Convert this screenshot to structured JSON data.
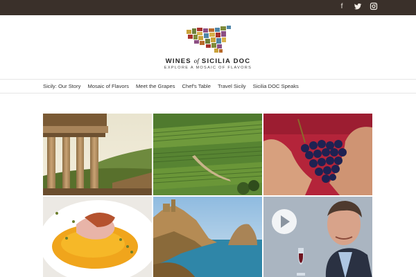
{
  "social": {
    "icons": [
      "facebook-icon",
      "twitter-icon",
      "instagram-icon"
    ]
  },
  "brand": {
    "title_before": "WINES",
    "title_of": "of",
    "title_after": "SICILIA DOC",
    "tagline": "EXPLORE A MOSAIC OF FLAVORS"
  },
  "nav": {
    "items": [
      "Sicily: Our Story",
      "Mosaic of Flavors",
      "Meet the Grapes",
      "Chef's Table",
      "Travel Sicily",
      "Sicilia DOC Speaks"
    ]
  },
  "gallery": {
    "tiles": [
      "temple-photo",
      "vineyard-photo",
      "grapes-photo",
      "food-photo",
      "coast-photo",
      "video-speaker-photo"
    ],
    "video_icon": "play-icon"
  },
  "colors": {
    "topbar": "#3a302a",
    "text": "#333333",
    "mosaic": [
      "#c9a23a",
      "#a8332e",
      "#6d7f3a",
      "#d8b14c",
      "#8c4f84",
      "#4f86a8",
      "#7f8b3a",
      "#b86a2c"
    ]
  }
}
